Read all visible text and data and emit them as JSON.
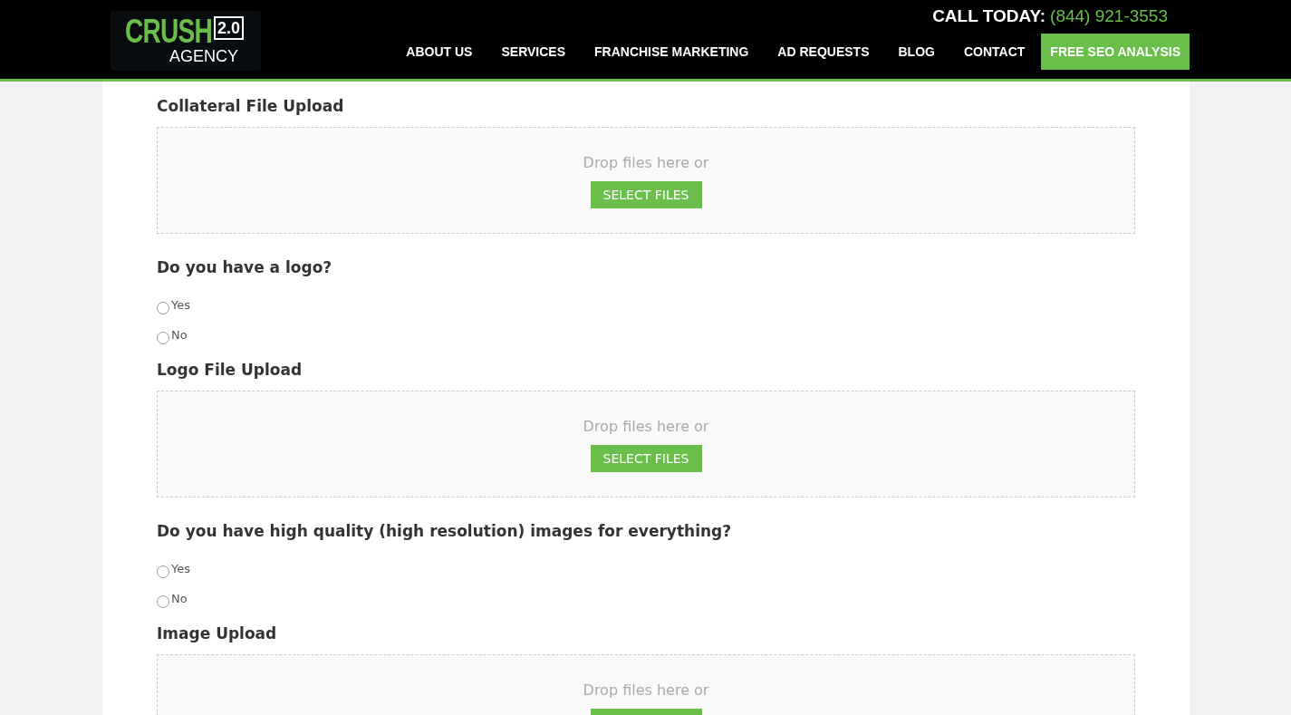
{
  "header": {
    "logo": {
      "word": "CRUSH",
      "version": "2.0",
      "sub": "AGENCY"
    },
    "call_label": "CALL TODAY:",
    "phone": "(844) 921-3553",
    "nav": [
      {
        "label": "ABOUT US",
        "kind": "link"
      },
      {
        "label": "SERVICES",
        "kind": "link"
      },
      {
        "label": "FRANCHISE MARKETING",
        "kind": "link"
      },
      {
        "label": "AD REQUESTS",
        "kind": "link"
      },
      {
        "label": "BLOG",
        "kind": "link"
      },
      {
        "label": "CONTACT",
        "kind": "link"
      },
      {
        "label": "FREE SEO ANALYSIS",
        "kind": "cta"
      }
    ]
  },
  "form": [
    {
      "kind": "upload",
      "label": "Collateral File Upload",
      "drop_text": "Drop files here or",
      "button": "SELECT FILES"
    },
    {
      "kind": "radio",
      "label": "Do you have a logo?",
      "options": [
        {
          "label": "Yes",
          "selected": false
        },
        {
          "label": "No",
          "selected": false
        }
      ]
    },
    {
      "kind": "upload",
      "label": "Logo File Upload",
      "drop_text": "Drop files here or",
      "button": "SELECT FILES"
    },
    {
      "kind": "radio",
      "label": "Do you have high quality (high resolution) images for everything?",
      "options": [
        {
          "label": "Yes",
          "selected": false
        },
        {
          "label": "No",
          "selected": false
        }
      ]
    },
    {
      "kind": "upload",
      "label": "Image Upload",
      "drop_text": "Drop files here or"
    }
  ]
}
